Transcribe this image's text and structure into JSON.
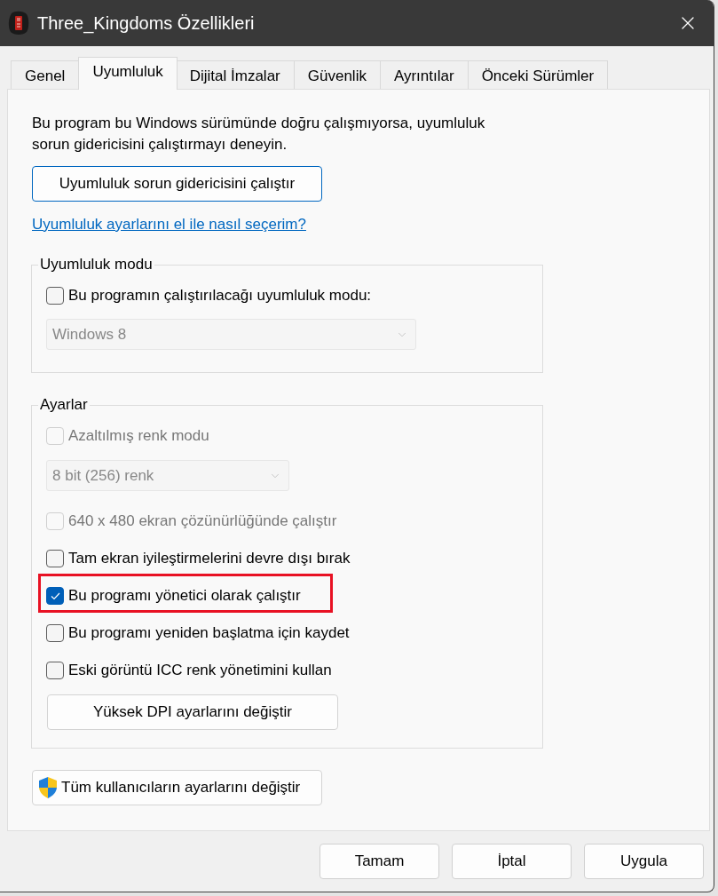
{
  "window": {
    "title": "Three_Kingdoms Özellikleri"
  },
  "tabs": [
    {
      "label": "Genel",
      "selected": false
    },
    {
      "label": "Uyumluluk",
      "selected": true
    },
    {
      "label": "Dijital İmzalar",
      "selected": false
    },
    {
      "label": "Güvenlik",
      "selected": false
    },
    {
      "label": "Ayrıntılar",
      "selected": false
    },
    {
      "label": "Önceki Sürümler",
      "selected": false
    }
  ],
  "intro_text": "Bu program bu Windows sürümünde doğru çalışmıyorsa, uyumluluk sorun gidericisini çalıştırmayı deneyin.",
  "troubleshooter_button": {
    "label": "Uyumluluk sorun gidericisini çalıştır",
    "focused": true
  },
  "help_link": "Uyumluluk ayarlarını el ile nasıl seçerim?",
  "compatibility_mode": {
    "title": "Uyumluluk modu",
    "checkbox": {
      "label": "Bu programın çalıştırılacağı uyumluluk modu:",
      "checked": false,
      "disabled": false
    },
    "dropdown": {
      "value": "Windows 8",
      "disabled": true
    }
  },
  "settings": {
    "title": "Ayarlar",
    "items": [
      {
        "kind": "checkbox",
        "label": "Azaltılmış renk modu",
        "checked": false,
        "disabled": true,
        "highlighted": false
      },
      {
        "kind": "dropdown",
        "value": "8 bit (256) renk",
        "disabled": true
      },
      {
        "kind": "checkbox",
        "label": "640 x 480 ekran çözünürlüğünde çalıştır",
        "checked": false,
        "disabled": true,
        "highlighted": false
      },
      {
        "kind": "checkbox",
        "label": "Tam ekran iyileştirmelerini devre dışı bırak",
        "checked": false,
        "disabled": false,
        "highlighted": false
      },
      {
        "kind": "checkbox",
        "label": "Bu programı yönetici olarak çalıştır",
        "checked": true,
        "disabled": false,
        "highlighted": true
      },
      {
        "kind": "checkbox",
        "label": "Bu programı yeniden başlatma için kaydet",
        "checked": false,
        "disabled": false,
        "highlighted": false
      },
      {
        "kind": "checkbox",
        "label": "Eski görüntü ICC renk yönetimini kullan",
        "checked": false,
        "disabled": false,
        "highlighted": false
      },
      {
        "kind": "button",
        "label": "Yüksek DPI ayarlarını değiştir"
      }
    ]
  },
  "all_users_button": "Tüm kullanıcıların ayarlarını değiştir",
  "buttons": [
    "Tamam",
    "İptal",
    "Uygula"
  ]
}
